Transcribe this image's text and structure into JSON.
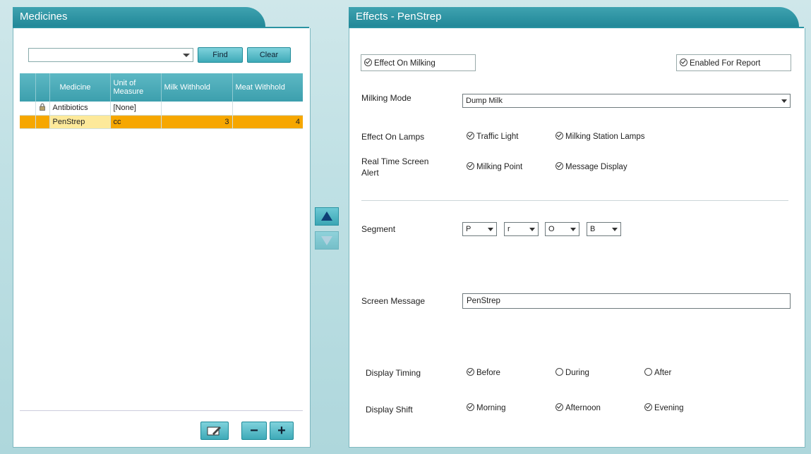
{
  "medicines": {
    "title": "Medicines",
    "search_value": "",
    "find_label": "Find",
    "clear_label": "Clear",
    "columns": [
      "",
      "",
      "Medicine",
      "Unit of Measure",
      "Milk Withhold",
      "Meat Withhold"
    ],
    "rows": [
      {
        "locked": true,
        "medicine": "Antibiotics",
        "unit": "[None]",
        "milk": "",
        "meat": "",
        "selected": false
      },
      {
        "locked": false,
        "medicine": "PenStrep",
        "unit": "cc",
        "milk": "3",
        "meat": "4",
        "selected": true
      }
    ],
    "minus_label": "−",
    "plus_label": "+"
  },
  "effects": {
    "title": "Effects - PenStrep",
    "effect_on_milking": "Effect On Milking",
    "enabled_for_report": "Enabled For Report",
    "milking_mode_label": "Milking Mode",
    "milking_mode_value": "Dump Milk",
    "effect_on_lamps_label": "Effect On Lamps",
    "traffic_light": "Traffic Light",
    "milking_station_lamps": "Milking Station Lamps",
    "real_time_alert_label": "Real Time Screen Alert",
    "milking_point": "Milking Point",
    "message_display": "Message Display",
    "segment_label": "Segment",
    "segments": [
      "P",
      "r",
      "O",
      "B"
    ],
    "screen_message_label": "Screen Message",
    "screen_message_value": "PenStrep",
    "display_timing_label": "Display Timing",
    "timing_before": "Before",
    "timing_during": "During",
    "timing_after": "After",
    "display_shift_label": "Display Shift",
    "shift_morning": "Morning",
    "shift_afternoon": "Afternoon",
    "shift_evening": "Evening"
  },
  "colors": {
    "accent": "#2a93a2",
    "selected_row": "#f6a700",
    "selected_cell": "#fde99a"
  }
}
